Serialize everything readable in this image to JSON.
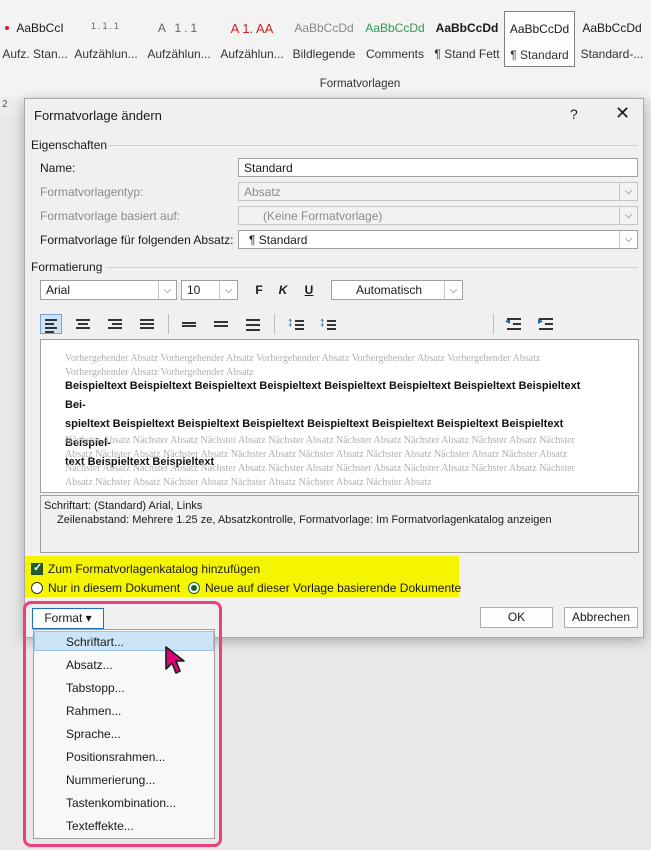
{
  "ribbon": {
    "styles": [
      {
        "preview": "AaBbCcI",
        "label": "Aufz. Stan..."
      },
      {
        "preview": "1.1.1",
        "label": "Aufzählun..."
      },
      {
        "preview": "A 1.1",
        "label": "Aufzählun..."
      },
      {
        "preview": "A  1.  AA",
        "label": "Aufzählun..."
      },
      {
        "preview": "AaBbCcDd",
        "label": "Bildlegende"
      },
      {
        "preview": "AaBbCcDd",
        "label": "Comments"
      },
      {
        "preview": "AaBbCcDd",
        "label": "¶ Stand Fett"
      },
      {
        "preview": "AaBbCcDd",
        "label": "¶ Standard"
      },
      {
        "preview": "AaBbCcDd",
        "label": "Standard-..."
      }
    ],
    "group_label": "Formatvorlagen",
    "ruler_mark": "2"
  },
  "dialog": {
    "title": "Formatvorlage ändern",
    "help": "?",
    "close": "✕",
    "properties_label": "Eigenschaften",
    "name_label": "Name:",
    "name_value": "Standard",
    "type_label": "Formatvorlagentyp:",
    "type_value": "Absatz",
    "based_on_label": "Formatvorlage basiert auf:",
    "based_on_value": "(Keine Formatvorlage)",
    "next_label": "Formatvorlage für folgenden Absatz:",
    "next_value": "¶  Standard",
    "formatting_label": "Formatierung",
    "font": "Arial",
    "size": "10",
    "bold": "F",
    "italic": "K",
    "underline": "U",
    "color": "Automatisch",
    "preview_before": "Vorhergehender Absatz Vorhergehender Absatz Vorhergehender Absatz Vorhergehender Absatz Vorhergehender Absatz Vorhergehender Absatz Vorhergehender Absatz",
    "preview_sample_1": "Beispieltext Beispieltext Beispieltext Beispieltext Beispieltext Beispieltext Beispieltext Beispieltext Bei-",
    "preview_sample_2": "spieltext Beispieltext Beispieltext Beispieltext Beispieltext Beispieltext Beispieltext Beispieltext Beispiel-",
    "preview_sample_3": "text Beispieltext Beispieltext",
    "preview_after": "Nächster Absatz Nächster Absatz Nächster Absatz Nächster Absatz Nächster Absatz Nächster Absatz Nächster Absatz Nächster Absatz Nächster Absatz Nächster Absatz Nächster Absatz Nächster Absatz Nächster Absatz Nächster Absatz Nächster Absatz Nächster Absatz Nächster Absatz Nächster Absatz Nächster Absatz Nächster Absatz Nächster Absatz Nächster Absatz Nächster Absatz Nächster Absatz Nächster Absatz Nächster Absatz Nächster Absatz Nächster Absatz",
    "desc_line1": "Schriftart: (Standard) Arial, Links",
    "desc_line2": "Zeilenabstand:  Mehrere 1.25 ze, Absatzkontrolle, Formatvorlage: Im Formatvorlagenkatalog anzeigen",
    "add_to_gallery": "Zum Formatvorlagenkatalog hinzufügen",
    "only_this_doc": "Nur in diesem Dokument",
    "new_docs": "Neue auf dieser Vorlage basierende Dokumente",
    "format_button": "Format ▾",
    "ok": "OK",
    "cancel": "Abbrechen"
  },
  "menu": {
    "items": [
      "Schriftart...",
      "Absatz...",
      "Tabstopp...",
      "Rahmen...",
      "Sprache...",
      "Positionsrahmen...",
      "Nummerierung...",
      "Tastenkombination...",
      "Texteffekte..."
    ]
  },
  "colors": {
    "highlight_yellow": "#f5f500",
    "callout_pink": "#ee3f78",
    "cursor_pink": "#e4007c",
    "check_green": "#1f5e32"
  }
}
